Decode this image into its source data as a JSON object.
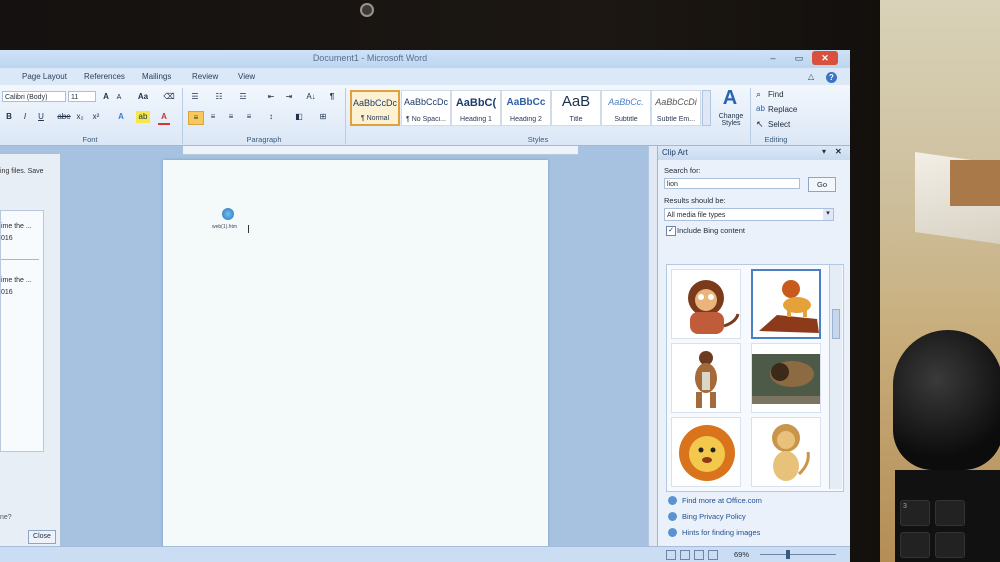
{
  "window": {
    "title": "Document1 - Microsoft Word",
    "controls": {
      "minimize": "–",
      "maximize": "▭",
      "close": "✕"
    }
  },
  "menu": {
    "tabs": [
      "Page Layout",
      "References",
      "Mailings",
      "Review",
      "View"
    ],
    "help": "?",
    "minimize_ribbon": "△"
  },
  "ribbon": {
    "font": {
      "name": "Calibri (Body)",
      "size": "11",
      "buttons": {
        "grow": "A",
        "shrink": "A",
        "change_case": "Aa",
        "clear": "⌫",
        "bold": "B",
        "italic": "I",
        "underline": "U",
        "strike": "abe",
        "subscript": "x₂",
        "superscript": "x²",
        "text_effects": "A",
        "highlight": "ab",
        "font_color": "A"
      },
      "label": "Font"
    },
    "paragraph": {
      "label": "Paragraph",
      "buttons": {
        "bullets": "☰",
        "numbering": "☷",
        "multilevel": "☲",
        "decrease_indent": "⇤",
        "increase_indent": "⇥",
        "sort": "A↓",
        "show_marks": "¶",
        "align_left": "≡",
        "center": "≡",
        "align_right": "≡",
        "justify": "≡",
        "line_spacing": "↕",
        "shading": "◧",
        "borders": "⊞"
      }
    },
    "styles": {
      "label": "Styles",
      "items": [
        {
          "sample": "AaBbCcDc",
          "name": "¶ Normal"
        },
        {
          "sample": "AaBbCcDc",
          "name": "¶ No Spaci..."
        },
        {
          "sample": "AaBbC(",
          "name": "Heading 1"
        },
        {
          "sample": "AaBbCc",
          "name": "Heading 2"
        },
        {
          "sample": "AaB",
          "name": "Title"
        },
        {
          "sample": "AaBbCc.",
          "name": "Subtitle"
        },
        {
          "sample": "AaBbCcDi",
          "name": "Subtle Em..."
        }
      ],
      "change_styles": "Change Styles"
    },
    "editing": {
      "label": "Editing",
      "find": "Find",
      "replace": "Replace",
      "select": "Select"
    }
  },
  "left_pane": {
    "intro_text": "ing files. Save",
    "entries": [
      {
        "line1": "ime the ...",
        "line2": "016"
      },
      {
        "line1": "ime the ...",
        "line2": "016"
      }
    ],
    "footer_text": "ne?",
    "close_button": "Close"
  },
  "document": {
    "file_label": "web(1).htm"
  },
  "clip_art": {
    "title": "Clip Art",
    "search_label": "Search for:",
    "search_value": "lion",
    "go_button": "Go",
    "results_label": "Results should be:",
    "media_type": "All media file types",
    "include_bing": "Include Bing content",
    "include_bing_checked": true,
    "results": [
      {
        "icon": "cartoon-lion-sitting-icon"
      },
      {
        "icon": "lion-on-rock-icon"
      },
      {
        "icon": "caveman-icon"
      },
      {
        "icon": "lion-photo-icon"
      },
      {
        "icon": "lion-face-icon"
      },
      {
        "icon": "lion-cub-icon"
      }
    ],
    "links": [
      "Find more at Office.com",
      "Bing Privacy Policy",
      "Hints for finding images"
    ]
  },
  "status_bar": {
    "zoom": "69%"
  }
}
